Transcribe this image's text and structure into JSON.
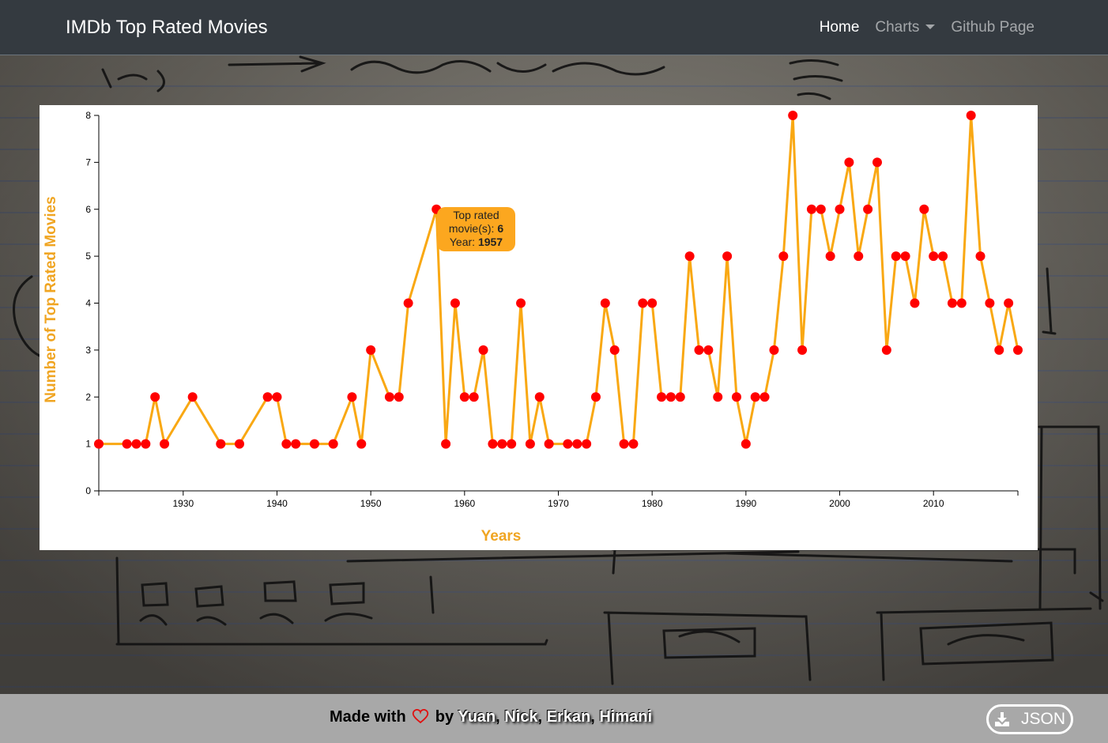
{
  "navbar": {
    "brand": "IMDb Top Rated Movies",
    "links": [
      {
        "label": "Home",
        "active": true
      },
      {
        "label": "Charts",
        "dropdown": true
      },
      {
        "label": "Github Page"
      }
    ]
  },
  "tooltip": {
    "line1": "Top rated",
    "line2_prefix": "movie(s): ",
    "line2_value": "6",
    "line3_prefix": "Year: ",
    "line3_value": "1957"
  },
  "footer": {
    "made_with": "Made with",
    "by": "by",
    "authors": [
      "Yuan",
      "Nick",
      "Erkan",
      "Himani"
    ],
    "json_button": "JSON"
  },
  "colors": {
    "line": "#f9a813",
    "point": "#ff0000",
    "axis_title": "#f0a522",
    "navbar": "#343a40"
  },
  "chart_data": {
    "type": "line",
    "xlabel": "Years",
    "ylabel": "Number of Top Rated Movies",
    "xlim": [
      1921,
      2019
    ],
    "ylim": [
      0,
      8
    ],
    "x_ticks": [
      1930,
      1940,
      1950,
      1960,
      1970,
      1980,
      1990,
      2000,
      2010
    ],
    "y_ticks": [
      0,
      1,
      2,
      3,
      4,
      5,
      6,
      7,
      8
    ],
    "grid": false,
    "series": [
      {
        "x": [
          1921,
          1924,
          1925,
          1926,
          1927,
          1928,
          1931,
          1934,
          1936,
          1939,
          1940,
          1941,
          1942,
          1944,
          1946,
          1948,
          1949,
          1950,
          1952,
          1953,
          1954,
          1957,
          1958,
          1959,
          1960,
          1961,
          1962,
          1963,
          1964,
          1965,
          1966,
          1967,
          1968,
          1969,
          1971,
          1972,
          1973,
          1974,
          1975,
          1976,
          1977,
          1978,
          1979,
          1980,
          1981,
          1982,
          1983,
          1984,
          1985,
          1986,
          1987,
          1988,
          1989,
          1990,
          1991,
          1992,
          1993,
          1994,
          1995,
          1996,
          1997,
          1998,
          1999,
          2000,
          2001,
          2002,
          2003,
          2004,
          2005,
          2006,
          2007,
          2008,
          2009,
          2010,
          2011,
          2012,
          2013,
          2014,
          2015,
          2016,
          2017,
          2018,
          2019
        ],
        "y": [
          1,
          1,
          1,
          1,
          2,
          1,
          2,
          1,
          1,
          2,
          2,
          1,
          1,
          1,
          1,
          2,
          1,
          3,
          2,
          2,
          4,
          6,
          1,
          4,
          2,
          2,
          3,
          1,
          1,
          1,
          4,
          1,
          2,
          1,
          1,
          1,
          1,
          2,
          4,
          3,
          1,
          1,
          4,
          4,
          2,
          2,
          2,
          5,
          3,
          3,
          2,
          5,
          2,
          1,
          2,
          2,
          3,
          5,
          8,
          3,
          6,
          6,
          5,
          6,
          7,
          5,
          6,
          7,
          3,
          5,
          5,
          4,
          6,
          5,
          5,
          4,
          4,
          8,
          5,
          4,
          3,
          4,
          3
        ]
      }
    ]
  }
}
